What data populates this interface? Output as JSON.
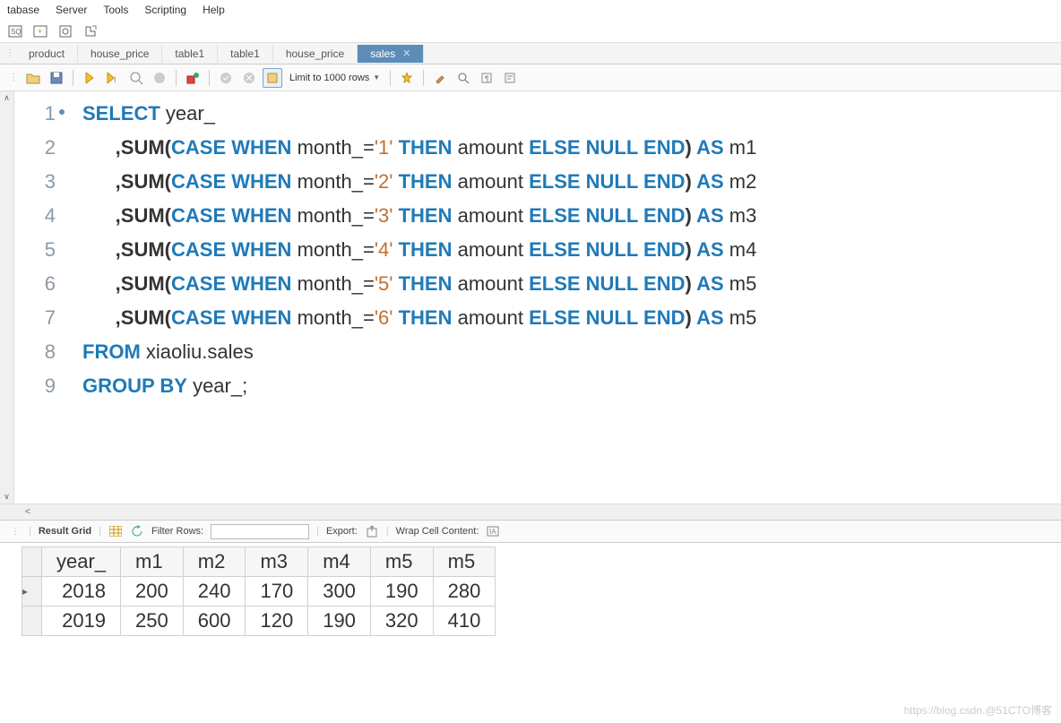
{
  "menu": {
    "items": [
      "tabase",
      "Server",
      "Tools",
      "Scripting",
      "Help"
    ]
  },
  "tabs": {
    "items": [
      "product",
      "house_price",
      "table1",
      "table1",
      "house_price",
      "sales"
    ],
    "activeIndex": 5
  },
  "toolbar2": {
    "limit": "Limit to 1000 rows"
  },
  "sql": {
    "lines": [
      {
        "n": "1",
        "tokens": [
          {
            "t": "SELECT",
            "c": "kw"
          },
          {
            "t": " year_",
            "c": ""
          }
        ]
      },
      {
        "n": "2",
        "tokens": [
          {
            "t": "      ,SUM(",
            "c": "fn"
          },
          {
            "t": "CASE WHEN",
            "c": "kw"
          },
          {
            "t": " month_",
            "c": ""
          },
          {
            "t": "=",
            "c": "op"
          },
          {
            "t": "'1'",
            "c": "str"
          },
          {
            "t": " ",
            "c": ""
          },
          {
            "t": "THEN",
            "c": "kw"
          },
          {
            "t": " amount ",
            "c": ""
          },
          {
            "t": "ELSE NULL END",
            "c": "kw"
          },
          {
            "t": ") ",
            "c": "fn"
          },
          {
            "t": "AS",
            "c": "kw"
          },
          {
            "t": " m1",
            "c": ""
          }
        ]
      },
      {
        "n": "3",
        "tokens": [
          {
            "t": "      ,SUM(",
            "c": "fn"
          },
          {
            "t": "CASE WHEN",
            "c": "kw"
          },
          {
            "t": " month_",
            "c": ""
          },
          {
            "t": "=",
            "c": "op"
          },
          {
            "t": "'2'",
            "c": "str"
          },
          {
            "t": " ",
            "c": ""
          },
          {
            "t": "THEN",
            "c": "kw"
          },
          {
            "t": " amount ",
            "c": ""
          },
          {
            "t": "ELSE NULL END",
            "c": "kw"
          },
          {
            "t": ") ",
            "c": "fn"
          },
          {
            "t": "AS",
            "c": "kw"
          },
          {
            "t": " m2",
            "c": ""
          }
        ]
      },
      {
        "n": "4",
        "tokens": [
          {
            "t": "      ,SUM(",
            "c": "fn"
          },
          {
            "t": "CASE WHEN",
            "c": "kw"
          },
          {
            "t": " month_",
            "c": ""
          },
          {
            "t": "=",
            "c": "op"
          },
          {
            "t": "'3'",
            "c": "str"
          },
          {
            "t": " ",
            "c": ""
          },
          {
            "t": "THEN",
            "c": "kw"
          },
          {
            "t": " amount ",
            "c": ""
          },
          {
            "t": "ELSE NULL END",
            "c": "kw"
          },
          {
            "t": ") ",
            "c": "fn"
          },
          {
            "t": "AS",
            "c": "kw"
          },
          {
            "t": " m3",
            "c": ""
          }
        ]
      },
      {
        "n": "5",
        "tokens": [
          {
            "t": "      ,SUM(",
            "c": "fn"
          },
          {
            "t": "CASE WHEN",
            "c": "kw"
          },
          {
            "t": " month_",
            "c": ""
          },
          {
            "t": "=",
            "c": "op"
          },
          {
            "t": "'4'",
            "c": "str"
          },
          {
            "t": " ",
            "c": ""
          },
          {
            "t": "THEN",
            "c": "kw"
          },
          {
            "t": " amount ",
            "c": ""
          },
          {
            "t": "ELSE NULL END",
            "c": "kw"
          },
          {
            "t": ") ",
            "c": "fn"
          },
          {
            "t": "AS",
            "c": "kw"
          },
          {
            "t": " m4",
            "c": ""
          }
        ]
      },
      {
        "n": "6",
        "tokens": [
          {
            "t": "      ,SUM(",
            "c": "fn"
          },
          {
            "t": "CASE WHEN",
            "c": "kw"
          },
          {
            "t": " month_",
            "c": ""
          },
          {
            "t": "=",
            "c": "op"
          },
          {
            "t": "'5'",
            "c": "str"
          },
          {
            "t": " ",
            "c": ""
          },
          {
            "t": "THEN",
            "c": "kw"
          },
          {
            "t": " amount ",
            "c": ""
          },
          {
            "t": "ELSE NULL END",
            "c": "kw"
          },
          {
            "t": ") ",
            "c": "fn"
          },
          {
            "t": "AS",
            "c": "kw"
          },
          {
            "t": " m5",
            "c": ""
          }
        ]
      },
      {
        "n": "7",
        "tokens": [
          {
            "t": "      ,SUM(",
            "c": "fn"
          },
          {
            "t": "CASE WHEN",
            "c": "kw"
          },
          {
            "t": " month_",
            "c": ""
          },
          {
            "t": "=",
            "c": "op"
          },
          {
            "t": "'6'",
            "c": "str"
          },
          {
            "t": " ",
            "c": ""
          },
          {
            "t": "THEN",
            "c": "kw"
          },
          {
            "t": " amount ",
            "c": ""
          },
          {
            "t": "ELSE NULL END",
            "c": "kw"
          },
          {
            "t": ") ",
            "c": "fn"
          },
          {
            "t": "AS",
            "c": "kw"
          },
          {
            "t": " m5",
            "c": ""
          }
        ]
      },
      {
        "n": "8",
        "tokens": [
          {
            "t": "FROM",
            "c": "kw"
          },
          {
            "t": " xiaoliu.sales",
            "c": ""
          }
        ]
      },
      {
        "n": "9",
        "tokens": [
          {
            "t": "GROUP BY",
            "c": "kw"
          },
          {
            "t": " year_;",
            "c": ""
          }
        ]
      }
    ]
  },
  "resultbar": {
    "label": "Result Grid",
    "filter": "Filter Rows:",
    "export": "Export:",
    "wrap": "Wrap Cell Content:"
  },
  "grid": {
    "columns": [
      "year_",
      "m1",
      "m2",
      "m3",
      "m4",
      "m5",
      "m5"
    ],
    "rows": [
      [
        "2018",
        "200",
        "240",
        "170",
        "300",
        "190",
        "280"
      ],
      [
        "2019",
        "250",
        "600",
        "120",
        "190",
        "320",
        "410"
      ]
    ]
  },
  "watermark": "https://blog.csdn.@51CTO博客"
}
